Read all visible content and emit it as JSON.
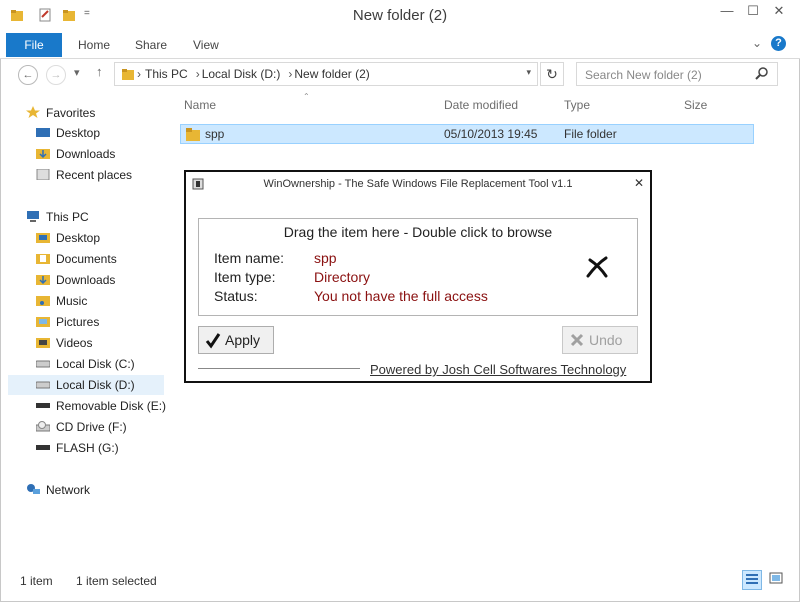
{
  "window": {
    "title": "New folder (2)",
    "controls": {
      "minimize": "—",
      "maximize": "☐",
      "close": "✕"
    }
  },
  "ribbon": {
    "tabs": [
      "File",
      "Home",
      "Share",
      "View"
    ],
    "expand_glyph": "⌄",
    "help_glyph": "?"
  },
  "address": {
    "back": "←",
    "forward": "→",
    "recent": "▾",
    "up": "↑",
    "path": [
      "This PC",
      "Local Disk (D:)",
      "New folder (2)"
    ],
    "separator": "›",
    "refresh": "↻"
  },
  "search": {
    "placeholder": "Search New folder (2)"
  },
  "nav": {
    "favorites_header": "Favorites",
    "favorites": [
      "Desktop",
      "Downloads",
      "Recent places"
    ],
    "thispc_header": "This PC",
    "thispc": [
      "Desktop",
      "Documents",
      "Downloads",
      "Music",
      "Pictures",
      "Videos",
      "Local Disk (C:)",
      "Local Disk (D:)",
      "Removable Disk (E:)",
      "CD Drive (F:)",
      "FLASH (G:)"
    ],
    "network": "Network"
  },
  "columns": [
    "Name",
    "Date modified",
    "Type",
    "Size"
  ],
  "files": [
    {
      "name": "spp",
      "date": "05/10/2013 19:45",
      "type": "File folder",
      "size": ""
    }
  ],
  "dialog": {
    "title": "WinOwnership - The Safe Windows File Replacement Tool v1.1",
    "close": "✕",
    "drag_text": "Drag the item here - Double click to browse",
    "item_name_label": "Item name:",
    "item_name_value": "spp",
    "item_type_label": "Item type:",
    "item_type_value": "Directory",
    "status_label": "Status:",
    "status_value": "You not have the full access",
    "apply_label": "Apply",
    "undo_label": "Undo",
    "powered_by": "Powered by Josh Cell Softwares Technology"
  },
  "statusbar": {
    "count": "1 item",
    "selected": "1 item selected"
  },
  "colors": {
    "accent": "#1979ca",
    "selection": "#cce8ff",
    "status_red": "#8a1010",
    "folder": "#e8b634"
  }
}
